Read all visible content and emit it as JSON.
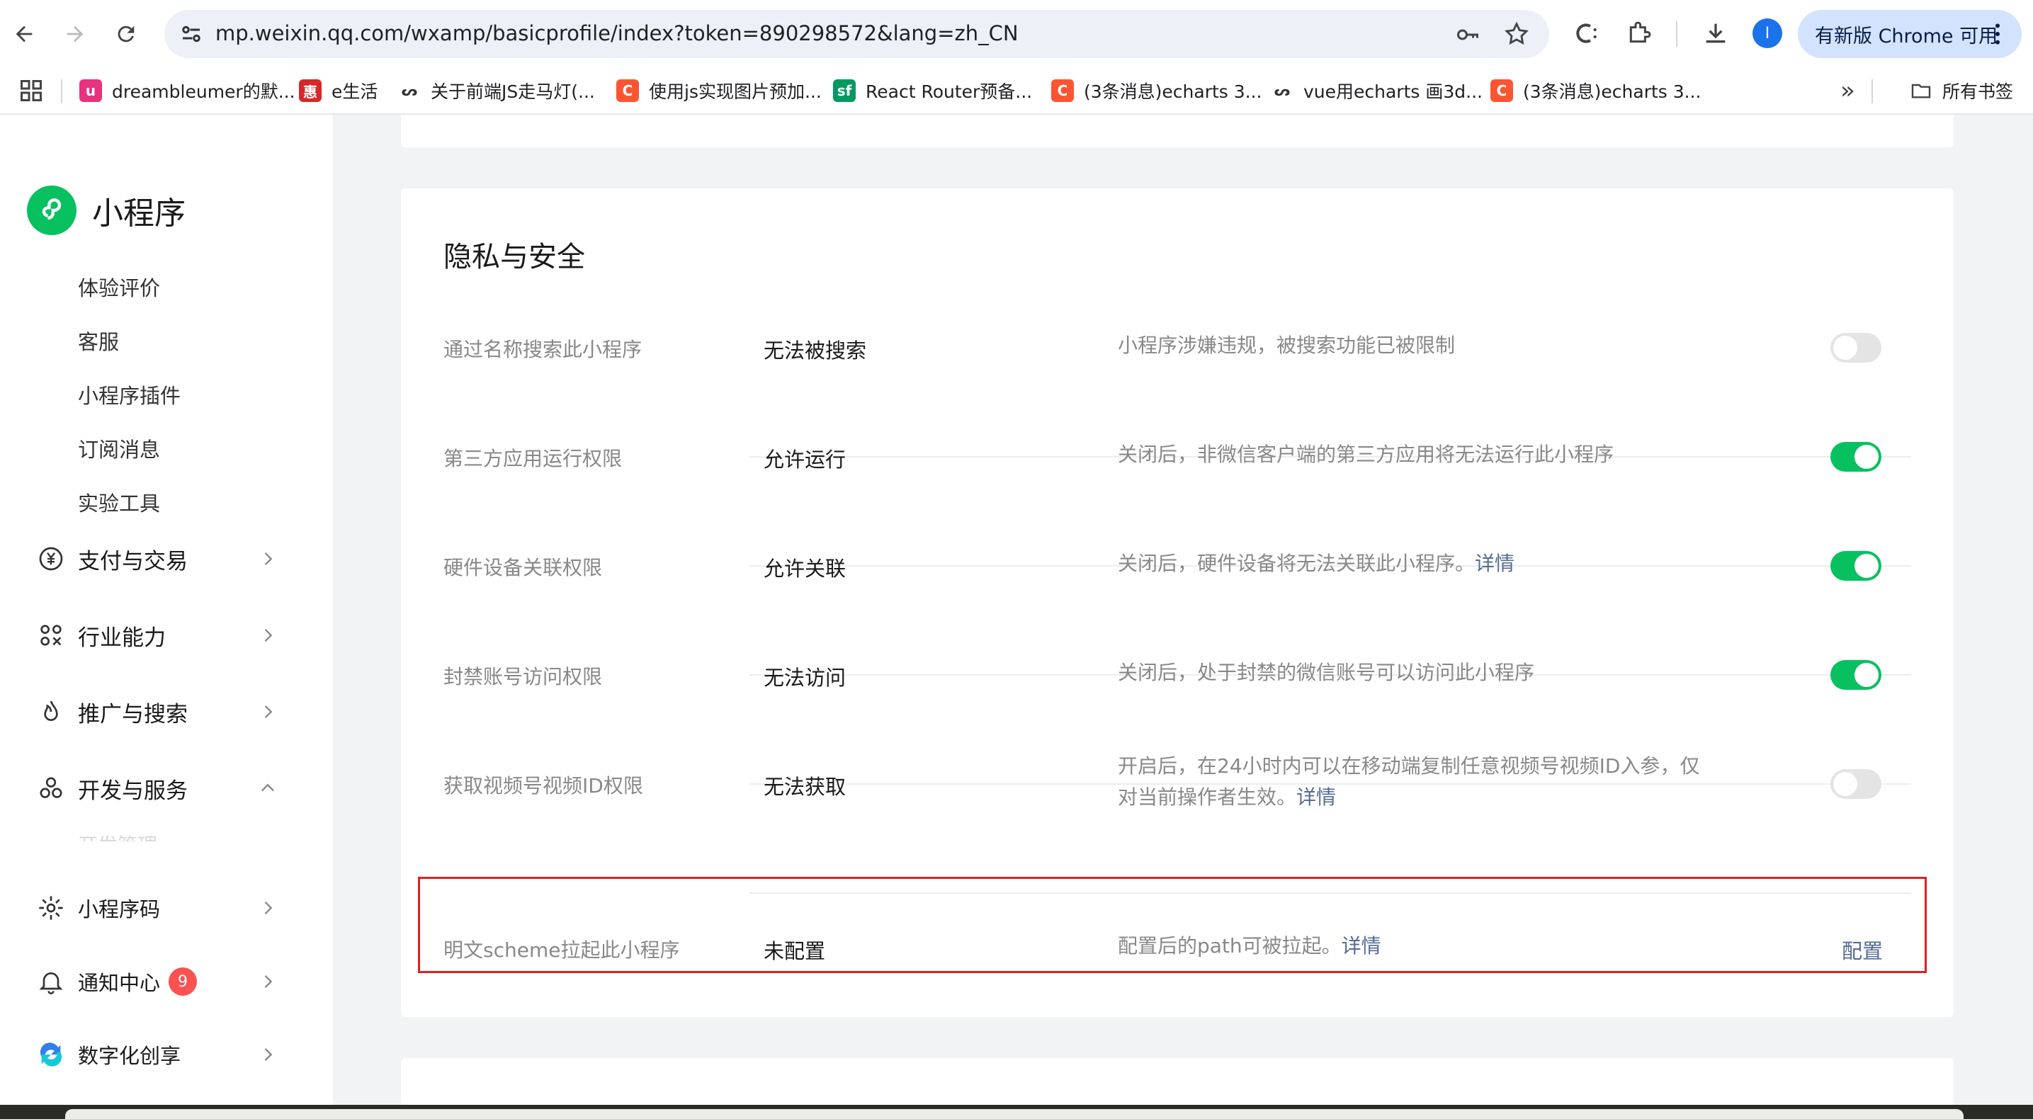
{
  "browser": {
    "url": "mp.weixin.qq.com/wxamp/basicprofile/index?token=890298572&lang=zh_CN",
    "profile_initial": "I",
    "update_label": "有新版 Chrome 可用",
    "bookmarks": [
      {
        "label": "dreambleumer的默...",
        "color": "#e8317f",
        "glyph": "u"
      },
      {
        "label": "e生活",
        "color": "#d62828",
        "glyph": "惠"
      },
      {
        "label": "关于前端JS走马灯(...",
        "color": "#ffffff",
        "glyph": "ᔕ"
      },
      {
        "label": "使用js实现图片预加...",
        "color": "#fc5531",
        "glyph": "C"
      },
      {
        "label": "React Router预备...",
        "color": "#009a61",
        "glyph": "sf"
      },
      {
        "label": "(3条消息)echarts 3...",
        "color": "#fc5531",
        "glyph": "C"
      },
      {
        "label": "vue用echarts 画3d...",
        "color": "#ffffff",
        "glyph": "ᔕ"
      },
      {
        "label": "(3条消息)echarts 3...",
        "color": "#fc5531",
        "glyph": "C"
      }
    ],
    "more_label": "»",
    "all_bookmarks_label": "所有书签"
  },
  "sidebar": {
    "app_name": "小程序",
    "sub_items": [
      "体验评价",
      "客服",
      "小程序插件",
      "订阅消息",
      "实验工具"
    ],
    "groups": [
      {
        "label": "支付与交易",
        "icon": "yen-icon"
      },
      {
        "label": "行业能力",
        "icon": "industry-icon"
      },
      {
        "label": "推广与搜索",
        "icon": "flame-icon"
      },
      {
        "label": "开发与服务",
        "icon": "dev-icon"
      }
    ],
    "faded_item": "开发管理",
    "bottom_items": [
      {
        "label": "小程序码",
        "icon": "sun-icon"
      },
      {
        "label": "通知中心",
        "icon": "bell-icon",
        "badge": "9"
      },
      {
        "label": "数字化创享",
        "icon": "digital-icon"
      }
    ]
  },
  "privacy": {
    "title": "隐私与安全",
    "rows": [
      {
        "label": "通过名称搜索此小程序",
        "status": "无法被搜索",
        "desc": "小程序涉嫌违规，被搜索功能已被限制",
        "link": "",
        "toggle": "off"
      },
      {
        "label": "第三方应用运行权限",
        "status": "允许运行",
        "desc": "关闭后，非微信客户端的第三方应用将无法运行此小程序",
        "link": "",
        "toggle": "on"
      },
      {
        "label": "硬件设备关联权限",
        "status": "允许关联",
        "desc": "关闭后，硬件设备将无法关联此小程序。",
        "link": "详情",
        "toggle": "on"
      },
      {
        "label": "封禁账号访问权限",
        "status": "无法访问",
        "desc": "关闭后，处于封禁的微信账号可以访问此小程序",
        "link": "",
        "toggle": "on"
      },
      {
        "label": "获取视频号视频ID权限",
        "status": "无法获取",
        "desc": "开启后，在24小时内可以在移动端复制任意视频号视频ID入参，仅对当前操作者生效。",
        "link": "详情",
        "toggle": "off"
      },
      {
        "label": "明文scheme拉起此小程序",
        "status": "未配置",
        "desc": "配置后的path可被拉起。",
        "link": "详情",
        "action": "配置"
      }
    ]
  }
}
